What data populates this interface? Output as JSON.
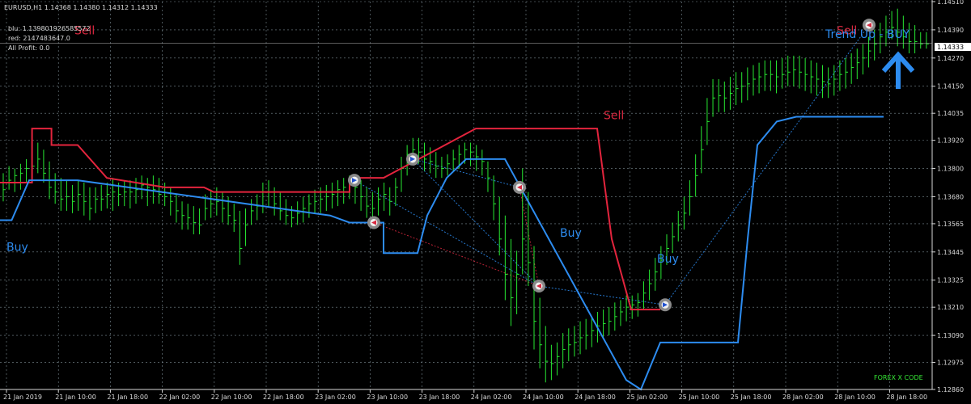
{
  "header": {
    "symbol_line": "EURUSD,H1  1.14368 1.14380 1.14312 1.14333",
    "blu_line": "blu: 1.139801926585572",
    "red_line": "red: 2147483647.0",
    "profit_line": "All Profit: 0.0"
  },
  "watermark": "FOREX X CODE",
  "current_price_label": "1.14333",
  "signal_labels": [
    {
      "text": "Sell",
      "kind": "sell",
      "x": 7.5,
      "y": 1.1437
    },
    {
      "text": "Sell",
      "kind": "sell",
      "x": 86,
      "y": 1.1437
    },
    {
      "text": "Sell",
      "kind": "sell",
      "x": 62,
      "y": 1.1401
    },
    {
      "text": "Buy",
      "kind": "buy",
      "x": 0.5,
      "y": 1.1345
    },
    {
      "text": "Buy",
      "kind": "buy",
      "x": 57.5,
      "y": 1.1351
    },
    {
      "text": "Buy",
      "kind": "buy",
      "x": 67.5,
      "y": 1.134
    }
  ],
  "trend_label": "Trend Up - BUY",
  "colors": {
    "background": "#000000",
    "grid": "#7c8c94",
    "candles": "#27e832",
    "red_line": "#e3243d",
    "blue_line": "#2d8cf0",
    "signal_blue": "#2d8cf0",
    "signal_red": "#d8283f",
    "arrow": "#2d8cf0"
  },
  "chart_data": {
    "type": "line",
    "symbol": "EURUSD",
    "timeframe": "H1",
    "ylim": [
      1.1286,
      1.1451
    ],
    "y_ticks": [
      "1.14510",
      "1.14390",
      "1.14270",
      "1.14150",
      "1.14035",
      "1.13920",
      "1.13800",
      "1.13680",
      "1.13565",
      "1.13445",
      "1.13325",
      "1.13210",
      "1.13090",
      "1.12975",
      "1.12860"
    ],
    "x_ticks": [
      "21 Jan 2019",
      "21 Jan 10:00",
      "21 Jan 18:00",
      "22 Jan 02:00",
      "22 Jan 10:00",
      "22 Jan 18:00",
      "23 Jan 02:00",
      "23 Jan 10:00",
      "23 Jan 18:00",
      "24 Jan 02:00",
      "24 Jan 10:00",
      "24 Jan 18:00",
      "25 Jan 02:00",
      "25 Jan 10:00",
      "25 Jan 18:00",
      "28 Jan 02:00",
      "28 Jan 10:00",
      "28 Jan 18:00"
    ],
    "bar_count": 161,
    "price_bars": [
      [
        1.1378,
        1.1366,
        1.1371
      ],
      [
        1.1381,
        1.1371,
        1.1375
      ],
      [
        1.138,
        1.137,
        1.1377
      ],
      [
        1.1382,
        1.1371,
        1.1378
      ],
      [
        1.1384,
        1.1374,
        1.138
      ],
      [
        1.1385,
        1.1374,
        1.1381
      ],
      [
        1.1391,
        1.1378,
        1.1384
      ],
      [
        1.1388,
        1.1374,
        1.1378
      ],
      [
        1.1383,
        1.1367,
        1.1372
      ],
      [
        1.1378,
        1.1365,
        1.137
      ],
      [
        1.1376,
        1.1362,
        1.1367
      ],
      [
        1.1375,
        1.1362,
        1.1368
      ],
      [
        1.1373,
        1.1361,
        1.1366
      ],
      [
        1.1375,
        1.1362,
        1.1369
      ],
      [
        1.1374,
        1.136,
        1.1366
      ],
      [
        1.1372,
        1.1358,
        1.1363
      ],
      [
        1.1372,
        1.1361,
        1.1367
      ],
      [
        1.1373,
        1.1362,
        1.1367
      ],
      [
        1.1374,
        1.1363,
        1.1369
      ],
      [
        1.1376,
        1.1362,
        1.137
      ],
      [
        1.1374,
        1.1364,
        1.1369
      ],
      [
        1.1375,
        1.1364,
        1.137
      ],
      [
        1.1375,
        1.1363,
        1.137
      ],
      [
        1.1376,
        1.1365,
        1.1371
      ],
      [
        1.1377,
        1.1367,
        1.1373
      ],
      [
        1.1376,
        1.1364,
        1.1372
      ],
      [
        1.1377,
        1.1365,
        1.1371
      ],
      [
        1.1376,
        1.1365,
        1.1369
      ],
      [
        1.1374,
        1.1364,
        1.1368
      ],
      [
        1.1372,
        1.136,
        1.1366
      ],
      [
        1.1369,
        1.1357,
        1.1362
      ],
      [
        1.1366,
        1.1354,
        1.136
      ],
      [
        1.1365,
        1.1354,
        1.1359
      ],
      [
        1.1364,
        1.1352,
        1.1357
      ],
      [
        1.1363,
        1.1352,
        1.1356
      ],
      [
        1.1369,
        1.1358,
        1.1363
      ],
      [
        1.1371,
        1.1359,
        1.1365
      ],
      [
        1.1372,
        1.136,
        1.1366
      ],
      [
        1.137,
        1.1357,
        1.1363
      ],
      [
        1.1368,
        1.1356,
        1.136
      ],
      [
        1.1365,
        1.1353,
        1.1358
      ],
      [
        1.1362,
        1.1339,
        1.1346
      ],
      [
        1.1363,
        1.1347,
        1.1356
      ],
      [
        1.1367,
        1.1356,
        1.1362
      ],
      [
        1.1369,
        1.1358,
        1.1364
      ],
      [
        1.1374,
        1.1361,
        1.137
      ],
      [
        1.1375,
        1.1364,
        1.137
      ],
      [
        1.1372,
        1.136,
        1.1365
      ],
      [
        1.137,
        1.1358,
        1.1362
      ],
      [
        1.1367,
        1.1356,
        1.136
      ],
      [
        1.1364,
        1.1355,
        1.1359
      ],
      [
        1.1366,
        1.1356,
        1.1361
      ],
      [
        1.1368,
        1.1357,
        1.1363
      ],
      [
        1.1369,
        1.1359,
        1.1365
      ],
      [
        1.1371,
        1.1361,
        1.1366
      ],
      [
        1.1372,
        1.1361,
        1.1367
      ],
      [
        1.1373,
        1.1362,
        1.1368
      ],
      [
        1.1374,
        1.1363,
        1.1369
      ],
      [
        1.1375,
        1.1364,
        1.1371
      ],
      [
        1.1376,
        1.1365,
        1.1372
      ],
      [
        1.1377,
        1.1367,
        1.1373
      ],
      [
        1.1377,
        1.1365,
        1.1372
      ],
      [
        1.1375,
        1.1362,
        1.1368
      ],
      [
        1.1372,
        1.1359,
        1.1364
      ],
      [
        1.137,
        1.1358,
        1.1363
      ],
      [
        1.1372,
        1.136,
        1.1367
      ],
      [
        1.1374,
        1.1362,
        1.1369
      ],
      [
        1.1372,
        1.136,
        1.1366
      ],
      [
        1.1376,
        1.1364,
        1.1372
      ],
      [
        1.1385,
        1.137,
        1.138
      ],
      [
        1.139,
        1.1377,
        1.1386
      ],
      [
        1.1393,
        1.1383,
        1.1388
      ],
      [
        1.1393,
        1.1382,
        1.1387
      ],
      [
        1.1391,
        1.1379,
        1.1384
      ],
      [
        1.1389,
        1.1378,
        1.1383
      ],
      [
        1.1387,
        1.1376,
        1.1381
      ],
      [
        1.1385,
        1.1376,
        1.138
      ],
      [
        1.1386,
        1.1377,
        1.1382
      ],
      [
        1.1388,
        1.1379,
        1.1384
      ],
      [
        1.139,
        1.138,
        1.1386
      ],
      [
        1.1391,
        1.1382,
        1.1388
      ],
      [
        1.1391,
        1.1381,
        1.1387
      ],
      [
        1.139,
        1.1379,
        1.1385
      ],
      [
        1.1388,
        1.1377,
        1.1383
      ],
      [
        1.1383,
        1.137,
        1.1376
      ],
      [
        1.1377,
        1.1358,
        1.1365
      ],
      [
        1.1368,
        1.1343,
        1.135
      ],
      [
        1.136,
        1.1324,
        1.1335
      ],
      [
        1.135,
        1.1313,
        1.1325
      ],
      [
        1.1345,
        1.1318,
        1.1335
      ],
      [
        1.138,
        1.1335,
        1.135
      ],
      [
        1.137,
        1.133,
        1.134
      ],
      [
        1.1347,
        1.1303,
        1.1315
      ],
      [
        1.1325,
        1.1295,
        1.1305
      ],
      [
        1.1313,
        1.1289,
        1.1298
      ],
      [
        1.1305,
        1.129,
        1.1297
      ],
      [
        1.1306,
        1.1292,
        1.13
      ],
      [
        1.131,
        1.1295,
        1.1303
      ],
      [
        1.1312,
        1.1298,
        1.1305
      ],
      [
        1.1313,
        1.13,
        1.1306
      ],
      [
        1.1315,
        1.1301,
        1.1308
      ],
      [
        1.1316,
        1.1303,
        1.1309
      ],
      [
        1.1317,
        1.1304,
        1.1311
      ],
      [
        1.1319,
        1.1306,
        1.1313
      ],
      [
        1.132,
        1.1308,
        1.1314
      ],
      [
        1.1321,
        1.1309,
        1.1315
      ],
      [
        1.1323,
        1.1311,
        1.1317
      ],
      [
        1.1324,
        1.1313,
        1.1319
      ],
      [
        1.1326,
        1.1315,
        1.1321
      ],
      [
        1.1326,
        1.1316,
        1.1322
      ],
      [
        1.1327,
        1.1317,
        1.1323
      ],
      [
        1.1332,
        1.132,
        1.1327
      ],
      [
        1.1337,
        1.1324,
        1.1331
      ],
      [
        1.1342,
        1.1328,
        1.1336
      ],
      [
        1.1347,
        1.1333,
        1.1341
      ],
      [
        1.1352,
        1.1339,
        1.1346
      ],
      [
        1.1357,
        1.1344,
        1.1351
      ],
      [
        1.1362,
        1.1349,
        1.1356
      ],
      [
        1.1368,
        1.1354,
        1.1361
      ],
      [
        1.1375,
        1.136,
        1.1368
      ],
      [
        1.1386,
        1.1368,
        1.1377
      ],
      [
        1.1398,
        1.1378,
        1.1388
      ],
      [
        1.141,
        1.139,
        1.14
      ],
      [
        1.1418,
        1.1402,
        1.141
      ],
      [
        1.1418,
        1.1404,
        1.1411
      ],
      [
        1.1417,
        1.1404,
        1.141
      ],
      [
        1.1419,
        1.1405,
        1.1412
      ],
      [
        1.1421,
        1.1407,
        1.1414
      ],
      [
        1.1421,
        1.1408,
        1.1415
      ],
      [
        1.1423,
        1.1409,
        1.1416
      ],
      [
        1.1424,
        1.1411,
        1.1418
      ],
      [
        1.1425,
        1.1412,
        1.1419
      ],
      [
        1.1426,
        1.1413,
        1.142
      ],
      [
        1.1426,
        1.1413,
        1.142
      ],
      [
        1.1426,
        1.1412,
        1.1419
      ],
      [
        1.1427,
        1.1414,
        1.142
      ],
      [
        1.1428,
        1.1415,
        1.1421
      ],
      [
        1.1428,
        1.1415,
        1.1422
      ],
      [
        1.1428,
        1.1414,
        1.1421
      ],
      [
        1.1427,
        1.1413,
        1.142
      ],
      [
        1.1426,
        1.1412,
        1.1419
      ],
      [
        1.1425,
        1.1411,
        1.1418
      ],
      [
        1.1424,
        1.141,
        1.1417
      ],
      [
        1.1423,
        1.141,
        1.1416
      ],
      [
        1.1424,
        1.1411,
        1.1418
      ],
      [
        1.1426,
        1.1413,
        1.142
      ],
      [
        1.1427,
        1.1414,
        1.1421
      ],
      [
        1.1429,
        1.1416,
        1.1423
      ],
      [
        1.1431,
        1.1418,
        1.1425
      ],
      [
        1.1433,
        1.142,
        1.1427
      ],
      [
        1.1436,
        1.1423,
        1.143
      ],
      [
        1.1439,
        1.1426,
        1.1433
      ],
      [
        1.1442,
        1.1429,
        1.1436
      ],
      [
        1.1445,
        1.1432,
        1.1438
      ],
      [
        1.1447,
        1.1435,
        1.144
      ],
      [
        1.1448,
        1.1432,
        1.1438
      ],
      [
        1.1445,
        1.1431,
        1.1436
      ],
      [
        1.1442,
        1.1429,
        1.1434
      ],
      [
        1.1441,
        1.1429,
        1.1434
      ],
      [
        1.1438,
        1.1431,
        1.1433
      ],
      [
        1.1438,
        1.1431,
        1.1433
      ]
    ],
    "red_level": [
      [
        0,
        1.1374
      ],
      [
        3.3,
        1.1374
      ],
      [
        3.3,
        1.1397
      ],
      [
        5.3,
        1.1397
      ],
      [
        5.3,
        1.139
      ],
      [
        8,
        1.139
      ],
      [
        11,
        1.1376
      ],
      [
        14,
        1.1374
      ],
      [
        17,
        1.1372
      ],
      [
        21,
        1.1372
      ],
      [
        22,
        1.137
      ],
      [
        33,
        1.137
      ],
      [
        33,
        1.137
      ],
      [
        36,
        1.137
      ],
      [
        36,
        1.1376
      ],
      [
        39.5,
        1.1376
      ],
      [
        49,
        1.1397
      ],
      [
        53,
        1.1397
      ],
      [
        60,
        1.1397
      ],
      [
        61.5,
        1.1397
      ],
      [
        63,
        1.135
      ],
      [
        65,
        1.132
      ],
      [
        67,
        1.132
      ],
      [
        68,
        1.132
      ]
    ],
    "blue_level": [
      [
        0,
        1.1358
      ],
      [
        1.2,
        1.1358
      ],
      [
        3,
        1.1375
      ],
      [
        4,
        1.1375
      ],
      [
        4,
        1.1375
      ],
      [
        8,
        1.1375
      ],
      [
        34,
        1.136
      ],
      [
        36,
        1.1357
      ],
      [
        39.5,
        1.1357
      ],
      [
        39.5,
        1.1344
      ],
      [
        43,
        1.1344
      ],
      [
        44,
        1.136
      ],
      [
        46,
        1.1376
      ],
      [
        48,
        1.1384
      ],
      [
        50,
        1.1384
      ],
      [
        52,
        1.1384
      ],
      [
        64.5,
        1.129
      ],
      [
        66,
        1.1286
      ],
      [
        68,
        1.1306
      ],
      [
        69,
        1.1306
      ],
      [
        72,
        1.1306
      ],
      [
        76,
        1.1306
      ],
      [
        77,
        1.135
      ],
      [
        78,
        1.139
      ],
      [
        80,
        1.14
      ],
      [
        82,
        1.1402
      ],
      [
        85,
        1.1402
      ],
      [
        91,
        1.1402
      ]
    ],
    "signal_markers": [
      {
        "x": 36.5,
        "y": 1.1375,
        "dir": "right"
      },
      {
        "x": 38.5,
        "y": 1.1357,
        "dir": "left"
      },
      {
        "x": 42.5,
        "y": 1.1384,
        "dir": "right"
      },
      {
        "x": 53.5,
        "y": 1.1372,
        "dir": "left"
      },
      {
        "x": 55.5,
        "y": 1.133,
        "dir": "left"
      },
      {
        "x": 68.5,
        "y": 1.1322,
        "dir": "right"
      },
      {
        "x": 89.5,
        "y": 1.1441,
        "dir": "left"
      }
    ],
    "signal_links": [
      {
        "from": 0,
        "to": 4,
        "color": "blue"
      },
      {
        "from": 1,
        "to": 4,
        "color": "red"
      },
      {
        "from": 2,
        "to": 3,
        "color": "blue"
      },
      {
        "from": 2,
        "to": 4,
        "color": "blue"
      },
      {
        "from": 3,
        "to": 4,
        "color": "red"
      },
      {
        "from": 4,
        "to": 5,
        "color": "blue"
      },
      {
        "from": 5,
        "to": 6,
        "color": "blue"
      }
    ],
    "current_price": 1.14333,
    "grid": true
  }
}
